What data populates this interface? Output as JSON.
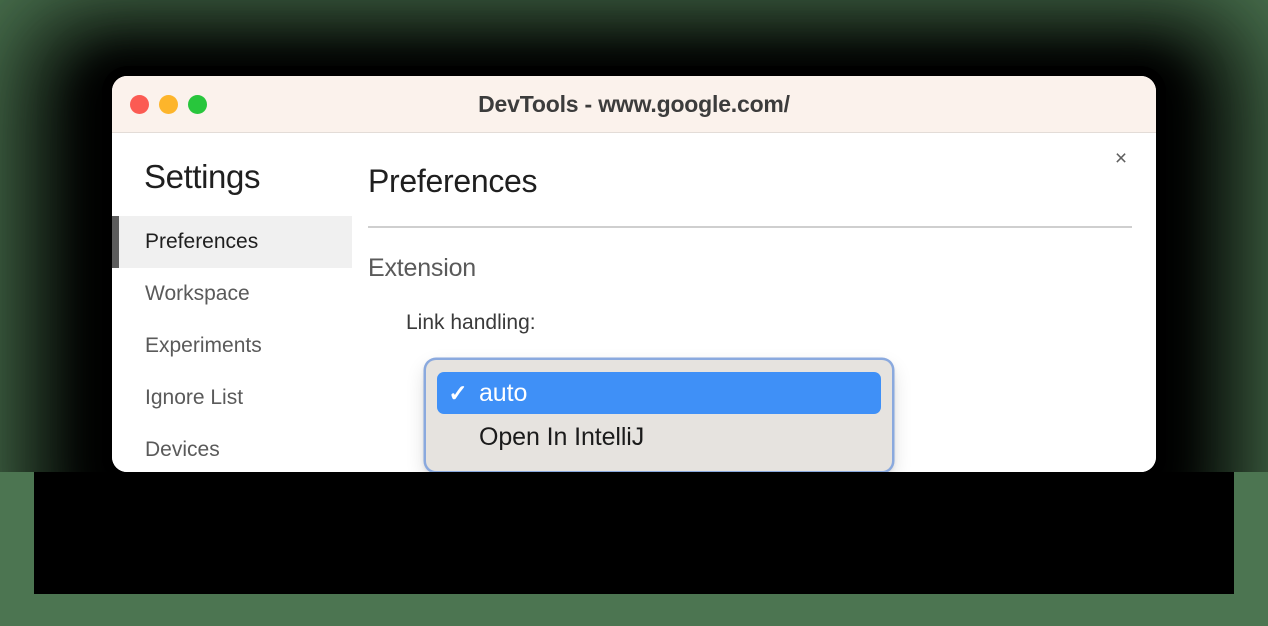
{
  "window": {
    "title": "DevTools - www.google.com/",
    "traffic_lights": [
      {
        "name": "close",
        "color": "#fb5b53"
      },
      {
        "name": "minimize",
        "color": "#fdb52b"
      },
      {
        "name": "zoom",
        "color": "#28c63c"
      }
    ],
    "close_icon": "×"
  },
  "sidebar": {
    "title": "Settings",
    "items": [
      {
        "label": "Preferences",
        "selected": true
      },
      {
        "label": "Workspace",
        "selected": false
      },
      {
        "label": "Experiments",
        "selected": false
      },
      {
        "label": "Ignore List",
        "selected": false
      },
      {
        "label": "Devices",
        "selected": false
      }
    ]
  },
  "main": {
    "page_title": "Preferences",
    "section_title": "Extension",
    "field_label": "Link handling:"
  },
  "popup_menu": {
    "selected_value": "auto",
    "check_glyph": "✓",
    "items": [
      {
        "label": "auto",
        "checked": true,
        "highlighted": true
      },
      {
        "label": "Open In IntelliJ",
        "checked": false,
        "highlighted": false
      }
    ]
  },
  "colors": {
    "page_background": "#4c7551",
    "titlebar_background": "#fbf2ec",
    "window_background": "#ffffff",
    "menu_highlight": "#3f90f7",
    "menu_background": "#e6e3df",
    "focus_ring": "#8aa9de",
    "sidebar_selected_background": "#f0f0f0",
    "sidebar_selected_accent": "#5c5c5c"
  }
}
